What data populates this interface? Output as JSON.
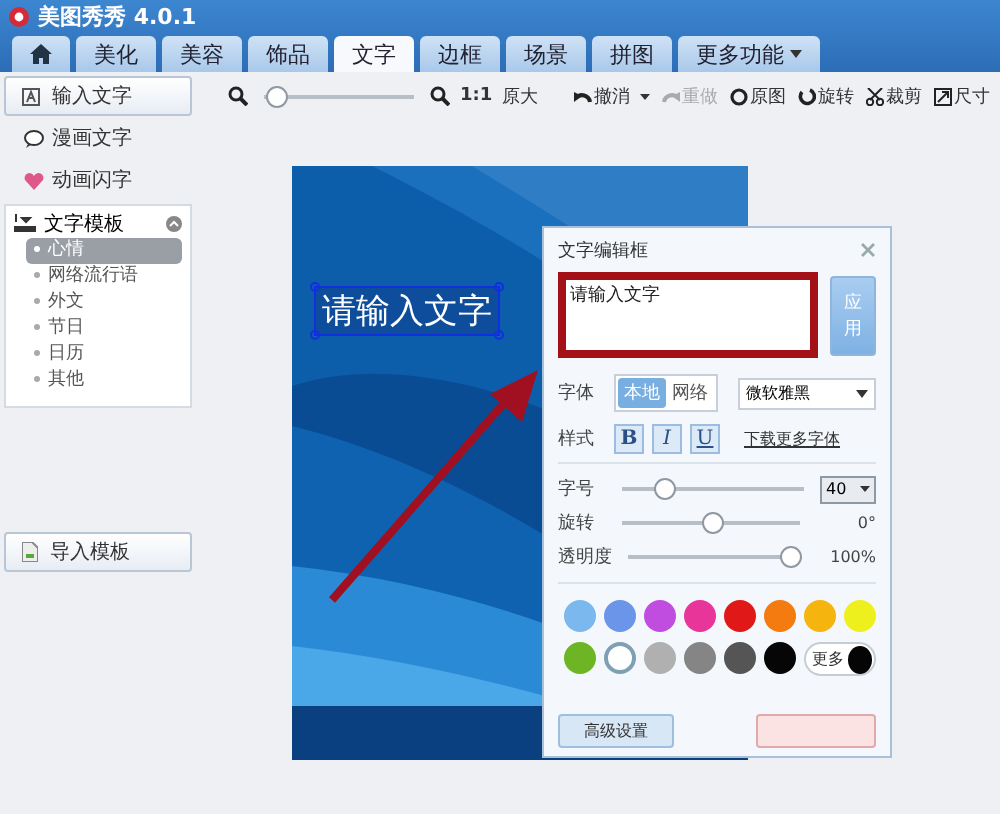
{
  "window": {
    "title": "美图秀秀 4.0.1"
  },
  "tabs": [
    {
      "kind": "home",
      "selected": false
    },
    {
      "kind": "text",
      "label": "美化",
      "selected": false
    },
    {
      "kind": "text",
      "label": "美容",
      "selected": false
    },
    {
      "kind": "text",
      "label": "饰品",
      "selected": false
    },
    {
      "kind": "text",
      "label": "文字",
      "selected": true
    },
    {
      "kind": "text",
      "label": "边框",
      "selected": false
    },
    {
      "kind": "text",
      "label": "场景",
      "selected": false
    },
    {
      "kind": "text",
      "label": "拼图",
      "selected": false
    },
    {
      "kind": "menu",
      "label": "更多功能",
      "selected": false
    }
  ],
  "toolbar": {
    "zoom": {
      "level": 0.02
    },
    "ratio": "1:1",
    "actual_size": "原大",
    "actions": [
      {
        "kind": "undo",
        "label": "撤消",
        "disabled": false
      },
      {
        "kind": "redo",
        "label": "重做",
        "disabled": true
      },
      {
        "kind": "original",
        "label": "原图",
        "disabled": false
      },
      {
        "kind": "rotate",
        "label": "旋转",
        "disabled": false
      },
      {
        "kind": "crop",
        "label": "裁剪",
        "disabled": false
      },
      {
        "kind": "size",
        "label": "尺寸",
        "disabled": false
      }
    ]
  },
  "sidebar": {
    "input_button": "输入文字",
    "items": [
      {
        "kind": "comic",
        "label": "漫画文字"
      },
      {
        "kind": "animated",
        "label": "动画闪字"
      }
    ],
    "templates": {
      "label": "文字模板",
      "expanded": true,
      "children": [
        {
          "label": "心情",
          "selected": true
        },
        {
          "label": "网络流行语",
          "selected": false
        },
        {
          "label": "外文",
          "selected": false
        },
        {
          "label": "节日",
          "selected": false
        },
        {
          "label": "日历",
          "selected": false
        },
        {
          "label": "其他",
          "selected": false
        }
      ]
    },
    "import_button": "导入模板"
  },
  "canvas": {
    "text": "请输入文字"
  },
  "dialog": {
    "title": "文字编辑框",
    "value": "请输入文字",
    "apply": "应用",
    "font_label": "字体",
    "font_sources": [
      {
        "label": "本地",
        "selected": true
      },
      {
        "label": "网络",
        "selected": false
      }
    ],
    "font": "微软雅黑",
    "style_label": "样式",
    "styles": [
      {
        "kind": "bold",
        "label": "B",
        "on": false
      },
      {
        "kind": "italic",
        "label": "I",
        "on": false
      },
      {
        "kind": "underline",
        "label": "U",
        "on": false
      }
    ],
    "download_link": "下载更多字体",
    "sliders": [
      {
        "label": "字号",
        "level": 0.2,
        "kind": "select",
        "value": "40"
      },
      {
        "label": "旋转",
        "level": 0.5,
        "kind": "reading",
        "reading": "0°"
      },
      {
        "label": "透明度",
        "level": 1,
        "kind": "reading",
        "reading": "100%"
      }
    ],
    "colors": [
      {
        "color": "#7ab8ee",
        "selected": false
      },
      {
        "color": "#6a95e8",
        "selected": false
      },
      {
        "color": "#c04de0",
        "selected": false
      },
      {
        "color": "#e8359a",
        "selected": false
      },
      {
        "color": "#e01818",
        "selected": false
      },
      {
        "color": "#f37b10",
        "selected": false
      },
      {
        "color": "#f6b40e",
        "selected": false
      },
      {
        "color": "#eef01e",
        "selected": false
      },
      {
        "color": "#6db525",
        "selected": false
      },
      {
        "color": "#ffffff",
        "selected": true
      },
      {
        "color": "#b0b0b0",
        "selected": false
      },
      {
        "color": "#858585",
        "selected": false
      },
      {
        "color": "#555555",
        "selected": false
      },
      {
        "color": "#060606",
        "selected": false
      }
    ],
    "more_colors": {
      "label": "更多",
      "color": "#050505"
    },
    "advanced": "高级设置"
  }
}
